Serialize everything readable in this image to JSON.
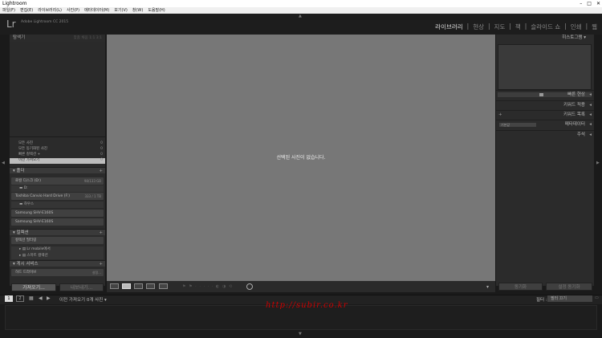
{
  "window": {
    "title": "Lightroom",
    "controls": [
      "–",
      "□",
      "✕"
    ]
  },
  "menu": [
    "파일(F)",
    "편집(E)",
    "라이브러리(L)",
    "사진(P)",
    "메타데이터(M)",
    "보기(V)",
    "창(W)",
    "도움말(H)"
  ],
  "brand": {
    "logo": "Lr",
    "product": "Adobe Lightroom CC 2015"
  },
  "modules": [
    {
      "label": "라이브러리",
      "active": true
    },
    {
      "label": "|",
      "active": false
    },
    {
      "label": "현상",
      "active": false
    },
    {
      "label": "|",
      "active": false
    },
    {
      "label": "지도",
      "active": false
    },
    {
      "label": "|",
      "active": false
    },
    {
      "label": "책",
      "active": false
    },
    {
      "label": "|",
      "active": false
    },
    {
      "label": "슬라이드 쇼",
      "active": false
    },
    {
      "label": "|",
      "active": false
    },
    {
      "label": "인쇄",
      "active": false
    },
    {
      "label": "|",
      "active": false
    },
    {
      "label": "웹",
      "active": false
    }
  ],
  "left": {
    "navigator": {
      "title": "탐색기",
      "options": "맞춤  채움  1:1  3:1"
    },
    "catalog": [
      {
        "label": "모든 사진",
        "count": "0"
      },
      {
        "label": "모든 동기화된 사진",
        "count": "0"
      },
      {
        "label": "빠른 컬렉션 +",
        "count": "0"
      },
      {
        "label": "이전 가져오기",
        "count": "0"
      }
    ],
    "folders_title": "폴더",
    "drives": [
      {
        "label": "로컬 디스크 (D:)",
        "info": "98/133 GB"
      },
      {
        "label": "Toshiba Canvio Hard Drive (F:)",
        "info": "333 / 1 TB"
      },
      {
        "label": "Samsung SHV-E160S",
        "info": ""
      },
      {
        "label": "Samsung SHV-E160S",
        "info": ""
      }
    ],
    "folder_rows": [
      "D:",
      "하우스"
    ],
    "collections_title": "컬렉션",
    "collection_filter": "컬렉션 필터링",
    "collections": [
      "Lr mobile에서",
      "스마트 컬렉션"
    ],
    "publish_title": "게시 서비스",
    "publish_row": "하드 드라이브",
    "publish_action": "설정...",
    "import_btn": "가져오기...",
    "export_btn": "내보내기..."
  },
  "centre": {
    "empty_message": "선택된 사진이 없습니다."
  },
  "right": {
    "histogram_title": "히스토그램",
    "sections": [
      {
        "label": "빠른 현상",
        "dropdown": ""
      },
      {
        "label": "키워드 적용",
        "dropdown": ""
      },
      {
        "label": "키워드 목록",
        "dropdown": ""
      },
      {
        "label": "메타데이터",
        "dropdown": "기본값"
      },
      {
        "label": "주석",
        "dropdown": ""
      }
    ],
    "sync_btn": "동기화",
    "syncset_btn": "설정 동기화"
  },
  "filmstrip": {
    "page_numbers": [
      "1",
      "2"
    ],
    "breadcrumb": "이전 가져오기    0개 사진 ▾",
    "filter_label": "필터 :",
    "filter_value": "필터 끄기"
  },
  "watermark": "http://subir.co.kr"
}
